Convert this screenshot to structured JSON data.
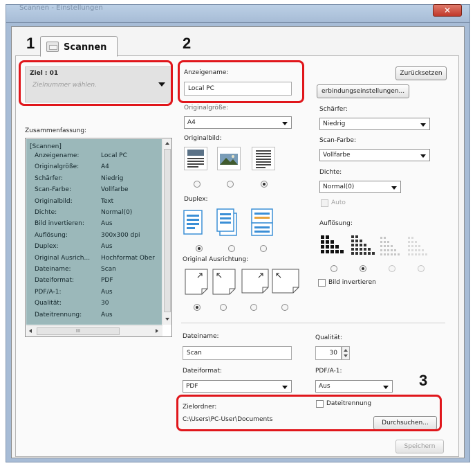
{
  "window": {
    "title": "Scannen - Einstellungen",
    "close_label": "✕"
  },
  "tab": {
    "label": "Scannen"
  },
  "callouts": {
    "one": "1",
    "two": "2",
    "three": "3"
  },
  "destination": {
    "label": "Ziel : 01",
    "placeholder": "Zielnummer wählen."
  },
  "display_name": {
    "label": "Anzeigename:",
    "value": "Local PC",
    "reset_button": "Zurücksetzen",
    "connection_button": "erbindungseinstellungen..."
  },
  "original_size": {
    "label": "Originalgröße:",
    "value": "A4"
  },
  "sharpness": {
    "label": "Schärfer:",
    "value": "Niedrig"
  },
  "scan_color": {
    "label": "Scan-Farbe:",
    "value": "Vollfarbe"
  },
  "density": {
    "label": "Dichte:",
    "value": "Normal(0)",
    "auto_label": "Auto"
  },
  "resolution": {
    "label": "Auflösung:",
    "invert_label": "Bild invertieren"
  },
  "summary": {
    "label": "Zusammenfassung:",
    "header": "[Scannen]",
    "rows": [
      {
        "k": "Anzeigename:",
        "v": "Local PC"
      },
      {
        "k": "Originalgröße:",
        "v": "A4"
      },
      {
        "k": "Schärfer:",
        "v": "Niedrig"
      },
      {
        "k": "Scan-Farbe:",
        "v": "Vollfarbe"
      },
      {
        "k": "Originalbild:",
        "v": "Text"
      },
      {
        "k": "Dichte:",
        "v": "Normal(0)"
      },
      {
        "k": "Bild invertieren:",
        "v": "Aus"
      },
      {
        "k": "Auflösung:",
        "v": "300x300 dpi"
      },
      {
        "k": "Duplex:",
        "v": "Aus"
      },
      {
        "k": "Original Ausrich...",
        "v": "Hochformat Ober"
      },
      {
        "k": "Dateiname:",
        "v": "Scan"
      },
      {
        "k": "Dateiformat:",
        "v": "PDF"
      },
      {
        "k": "PDF/A-1:",
        "v": "Aus"
      },
      {
        "k": "Qualität:",
        "v": "30"
      },
      {
        "k": "Dateitrennung:",
        "v": "Aus"
      }
    ],
    "scroll_thumb": "III"
  },
  "original_image": {
    "label": "Originalbild:"
  },
  "duplex": {
    "label": "Duplex:"
  },
  "orientation": {
    "label": "Original Ausrichtung:"
  },
  "file_name": {
    "label": "Dateiname:",
    "value": "Scan"
  },
  "quality": {
    "label": "Qualität:",
    "value": "30"
  },
  "file_format": {
    "label": "Dateiformat:",
    "value": "PDF"
  },
  "pdfa": {
    "label": "PDF/A-1:",
    "value": "Aus"
  },
  "target_folder": {
    "label": "Zielordner:",
    "value": "C:\\Users\\PC-User\\Documents",
    "browse_button": "Durchsuchen...",
    "split_label": "Dateitrennung"
  },
  "save_button": "Speichern",
  "colors": {
    "highlight": "#e0161b",
    "summary_bg": "#9bb8ba"
  }
}
